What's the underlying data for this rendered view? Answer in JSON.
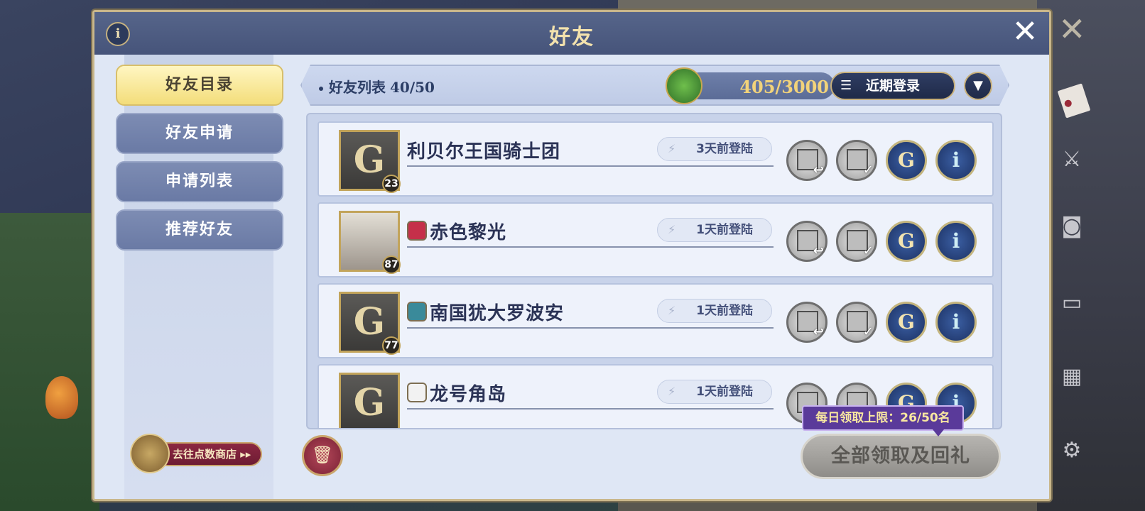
{
  "dialog": {
    "title": "好友",
    "info_label": "i",
    "close_label": "✕"
  },
  "sidebar": {
    "tabs": [
      {
        "label": "好友目录",
        "active": true
      },
      {
        "label": "好友申请",
        "active": false
      },
      {
        "label": "申请列表",
        "active": false
      },
      {
        "label": "推荐好友",
        "active": false
      }
    ],
    "shop_label": "去往点数商店 ▸▸"
  },
  "header": {
    "list_title": "好友列表",
    "list_count": "40/50",
    "heart_points": "405/3000",
    "sort_label": "近期登录",
    "dropdown_icon": "chevron-down-icon"
  },
  "friends": [
    {
      "name": "利贝尔王国骑士团",
      "level": "23",
      "last_login": "3天前登陆",
      "avatar": "guild-crest",
      "badge": ""
    },
    {
      "name": "赤色黎光",
      "level": "87",
      "last_login": "1天前登陆",
      "avatar": "portrait",
      "badge": "red"
    },
    {
      "name": "南国犹大罗波安",
      "level": "77",
      "last_login": "1天前登陆",
      "avatar": "guild-crest",
      "badge": "teal"
    },
    {
      "name": "龙号角岛",
      "level": "",
      "last_login": "1天前登陆",
      "avatar": "guild-crest",
      "badge": "white"
    }
  ],
  "bottom": {
    "daily_quota": "每日领取上限：26/50名",
    "claim_all_label": "全部领取及回礼"
  },
  "colors": {
    "active_tab": "#f3dd7a",
    "inactive_tab": "#6a7aa5",
    "heart_value": "#f2d37a",
    "quota_bg": "#5a3a9a"
  }
}
